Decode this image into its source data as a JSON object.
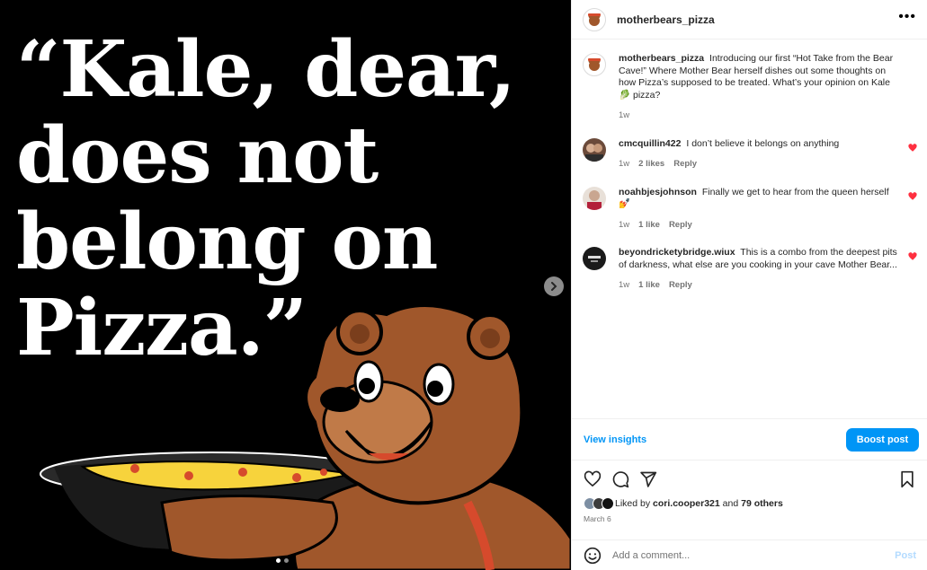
{
  "post": {
    "quote_lines": [
      "“Kale, dear,",
      "does not",
      "belong on",
      "Pizza.”"
    ],
    "carousel": {
      "count": 2,
      "active": 0
    }
  },
  "header": {
    "username": "motherbears_pizza",
    "more_icon": "more-horizontal-icon"
  },
  "caption": {
    "username": "motherbears_pizza",
    "text": "Introducing our first “Hot Take from the Bear Cave!” Where Mother Bear herself dishes out some thoughts on how Pizza’s supposed to be treated. What’s your opinion on Kale",
    "emoji": "🥬",
    "text_end": "pizza?",
    "time": "1w"
  },
  "comments": [
    {
      "username": "cmcquillin422",
      "text": "I don’t believe it belongs on anything",
      "emoji": "",
      "time": "1w",
      "likes": "2 likes",
      "reply": "Reply",
      "avatar_color": "#6b4a3a"
    },
    {
      "username": "noahbjesjohnson",
      "text": "Finally we get to hear from the queen herself",
      "emoji": "💅",
      "time": "1w",
      "likes": "1 like",
      "reply": "Reply",
      "avatar_color": "#c9a690"
    },
    {
      "username": "beyondricketybridge.wiux",
      "text": "This is a combo from the deepest pits of darkness, what else are you cooking in your cave Mother Bear...",
      "emoji": "",
      "time": "1w",
      "likes": "1 like",
      "reply": "Reply",
      "avatar_color": "#1a1a1a"
    }
  ],
  "insights": {
    "view_label": "View insights",
    "boost_label": "Boost post"
  },
  "actions": {
    "icons": [
      "heart-icon",
      "comment-icon",
      "share-icon",
      "bookmark-icon"
    ]
  },
  "likes": {
    "prefix": "Liked by",
    "user": "cori.cooper321",
    "joiner": "and",
    "others": "79 others"
  },
  "date": "March 6",
  "add_comment": {
    "placeholder": "Add a comment...",
    "post_label": "Post"
  },
  "colors": {
    "accent": "#0095f6",
    "heart": "#ff3040",
    "bear": "#a0572b",
    "pizza_cheese": "#f7d33c"
  }
}
